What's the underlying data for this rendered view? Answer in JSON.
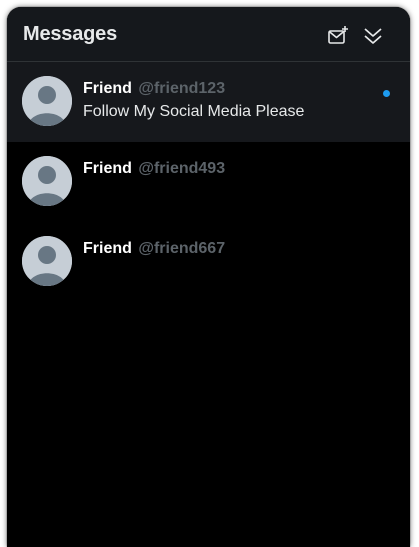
{
  "header": {
    "title": "Messages",
    "compose_icon": "new-message-icon",
    "collapse_icon": "collapse-chevrons-icon"
  },
  "colors": {
    "background": "#000000",
    "header_bg": "#15181c",
    "accent": "#1d9bf0",
    "handle_gray": "#5c6369"
  },
  "conversations": [
    {
      "name": "Friend",
      "handle": "@friend123",
      "preview": "Follow My Social Media Please",
      "unread": true,
      "selected": true
    },
    {
      "name": "Friend",
      "handle": "@friend493",
      "preview": "",
      "unread": false,
      "selected": false
    },
    {
      "name": "Friend",
      "handle": "@friend667",
      "preview": "",
      "unread": false,
      "selected": false
    }
  ]
}
